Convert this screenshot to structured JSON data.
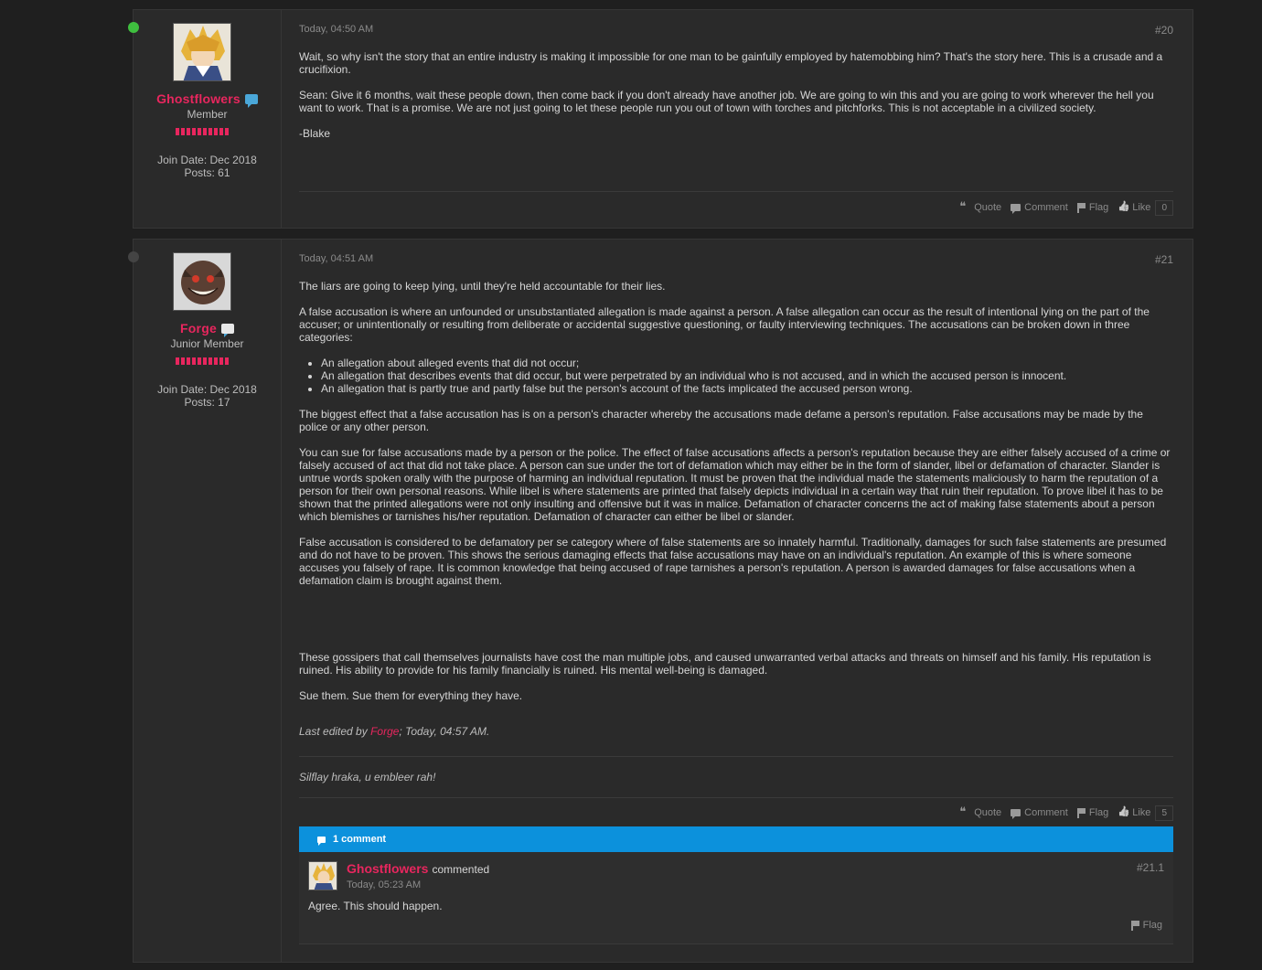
{
  "posts": [
    {
      "date": "Today, 04:50 AM",
      "number": "#20",
      "user": {
        "name": "Ghostflowers",
        "role": "Member",
        "join": "Join Date: Dec 2018",
        "posts": "Posts: 61",
        "online": true
      },
      "body": [
        "Wait, so why isn't the story that an entire industry is making it impossible for one man to be gainfully employed by hatemobbing him? That's the story here. This is a crusade and a crucifixion.",
        "Sean: Give it 6 months, wait these people down, then come back if you don't already have another job. We are going to win this and you are going to work wherever the hell you want to work. That is a promise. We are not just going to let these people run you out of town with torches and pitchforks. This is not acceptable in a civilized society.",
        "-Blake"
      ],
      "actions": {
        "quote": "Quote",
        "comment": "Comment",
        "flag": "Flag",
        "like": "Like",
        "like_count": "0"
      }
    },
    {
      "date": "Today, 04:51 AM",
      "number": "#21",
      "user": {
        "name": "Forge",
        "role": "Junior Member",
        "join": "Join Date: Dec 2018",
        "posts": "Posts: 17",
        "online": false
      },
      "body_intro": [
        "The liars are going to keep lying, until they're held accountable for their lies.",
        "A false accusation is where an unfounded or unsubstantiated allegation is made against a person. A false allegation can occur as the result of intentional lying on the part of the accuser; or unintentionally or resulting from deliberate or accidental suggestive questioning, or faulty interviewing techniques. The accusations can be broken down in three categories:"
      ],
      "body_list": [
        "An allegation about alleged events that did not occur;",
        "An allegation that describes events that did occur, but were perpetrated by an individual who is not accused, and in which the accused person is innocent.",
        "An allegation that is partly true and partly false but the person's account of the facts implicated the accused person wrong."
      ],
      "body_rest": [
        "The biggest effect that a false accusation has is on a person's character whereby the accusations made defame a person's reputation. False accusations may be made by the police or any other person.",
        "You can sue for false accusations made by a person or the police. The effect of false accusations affects a person's reputation because they are either falsely accused of a crime or falsely accused of act that did not take place. A person can sue under the tort of defamation which may either be in the form of slander, libel or defamation of character. Slander is untrue words spoken orally with the purpose of harming an individual reputation. It must be proven that the individual made the statements maliciously to harm the reputation of a person for their own personal reasons. While libel is where statements are printed that falsely depicts individual in a certain way that ruin their reputation. To prove libel it has to be shown that the printed allegations were not only insulting and offensive but it was in malice. Defamation of character concerns the act of making false statements about a person which blemishes or tarnishes his/her reputation. Defamation of character can either be libel or slander.",
        "False accusation is considered to be defamatory per se category where of false statements are so innately harmful. Traditionally, damages for such false statements are presumed and do not have to be proven. This shows the serious damaging effects that false accusations may have on an individual's reputation. An example of this is where someone accuses you falsely of rape. It is common knowledge that being accused of rape tarnishes a person's reputation. A person is awarded damages for false accusations when a defamation claim is brought against them."
      ],
      "body_end": [
        "These gossipers that call themselves journalists have cost the man multiple jobs, and caused unwarranted verbal attacks and threats on himself and his family. His reputation is ruined. His ability to provide for his family financially is ruined. His mental well-being is damaged.",
        "Sue them. Sue them for everything they have."
      ],
      "edited": {
        "prefix": "Last edited by ",
        "user": "Forge",
        "suffix": "; Today, 04:57 AM."
      },
      "signature": "Silflay hraka, u embleer rah!",
      "actions": {
        "quote": "Quote",
        "comment": "Comment",
        "flag": "Flag",
        "like": "Like",
        "like_count": "5"
      },
      "comments_bar": "1 comment",
      "comment": {
        "user": "Ghostflowers",
        "verb": "commented",
        "date": "Today, 05:23 AM",
        "number": "#21.1",
        "text": "Agree. This should happen.",
        "flag": "Flag"
      }
    }
  ],
  "colors": {
    "accent": "#e8265e",
    "comment_bar": "#0c91dc",
    "online": "#3fbf3f",
    "offline": "#444444"
  }
}
